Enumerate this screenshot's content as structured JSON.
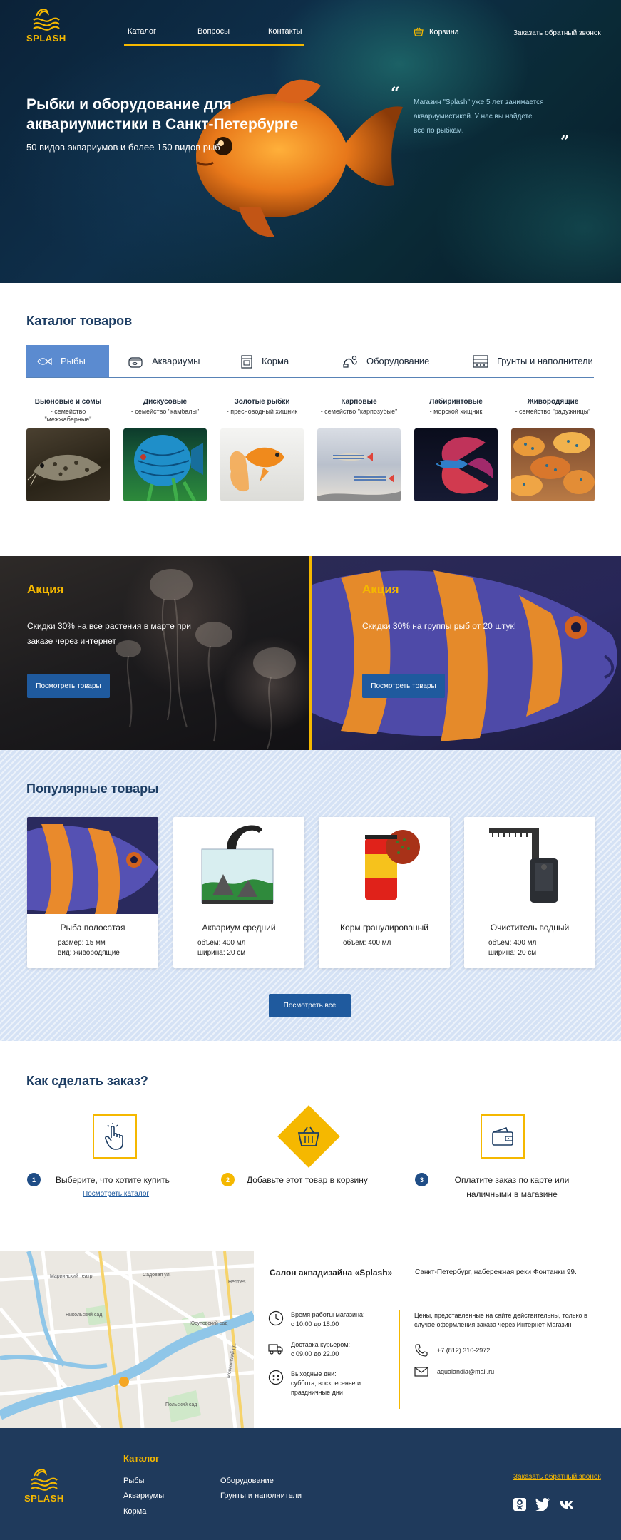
{
  "colors": {
    "accent": "#f5b800",
    "primary": "#1f5a9e",
    "heading": "#1d3d63",
    "tab_active": "#5b8bd0",
    "footer": "#1f3a5c"
  },
  "header": {
    "logo_text": "SPLASH",
    "nav": [
      "Каталог",
      "Вопросы",
      "Контакты"
    ],
    "cart_label": "Корзина",
    "callback": "Заказать обратный звонок"
  },
  "hero": {
    "title_line1": "Рыбки и оборудование для",
    "title_line2": "аквариумистики в Санкт-Петербурге",
    "subtitle": "50 видов аквариумов и более 150 видов рыб",
    "quote_line1": "Магазин \"Splash\" уже 5 лет занимается",
    "quote_line2": "аквариумистикой. У нас вы найдете",
    "quote_line3": "все по рыбкам."
  },
  "catalog": {
    "title": "Каталог товаров",
    "tabs": [
      {
        "label": "Рыбы",
        "icon": "fish-icon"
      },
      {
        "label": "Аквариумы",
        "icon": "aquarium-icon"
      },
      {
        "label": "Корма",
        "icon": "food-icon"
      },
      {
        "label": "Оборудование",
        "icon": "equipment-icon"
      },
      {
        "label": "Грунты и наполнители",
        "icon": "soil-icon"
      }
    ],
    "items": [
      {
        "name": "Вьюновые и сомы",
        "desc1": "- семейство",
        "desc2": "\"межжаберные\""
      },
      {
        "name": "Дискусовые",
        "desc1": "- семейство \"камбалы\"",
        "desc2": ""
      },
      {
        "name": "Золотые рыбки",
        "desc1": "- пресноводный хищник",
        "desc2": ""
      },
      {
        "name": "Карповые",
        "desc1": "- семейство \"карпозубые\"",
        "desc2": ""
      },
      {
        "name": "Лабиринтовые",
        "desc1": "- морской хищник",
        "desc2": ""
      },
      {
        "name": "Живородящие",
        "desc1": "- семейство \"радужницы\"",
        "desc2": ""
      }
    ]
  },
  "promos": [
    {
      "title": "Акция",
      "line1": "Скидки 30% на все растения в марте при",
      "line2": "заказе через интернет",
      "button": "Посмотреть товары"
    },
    {
      "title": "Акция",
      "line1": "Скидки 30% на группы рыб от 20 штук!",
      "line2": "",
      "button": "Посмотреть товары"
    }
  ],
  "popular": {
    "title": "Популярные товары",
    "products": [
      {
        "name": "Рыба полосатая",
        "spec1": "размер: 15 мм",
        "spec2": "вид: живородящие"
      },
      {
        "name": "Аквариум средний",
        "spec1": "объем: 400 мл",
        "spec2": "ширина: 20 см"
      },
      {
        "name": "Корм гранулированый",
        "spec1": "объем: 400 мл",
        "spec2": ""
      },
      {
        "name": "Очиститель водный",
        "spec1": "объем: 400 мл",
        "spec2": "ширина: 20 см"
      }
    ],
    "button": "Посмотреть все"
  },
  "order": {
    "title": "Как сделать заказ?",
    "steps": [
      {
        "num": "1",
        "text1": "Выберите, что хотите купить",
        "text2": "",
        "link": "Посмотреть каталог"
      },
      {
        "num": "2",
        "text1": "Добавьте этот товар в корзину",
        "text2": ""
      },
      {
        "num": "3",
        "text1": "Оплатите  заказ по карте или",
        "text2": "наличными в магазине"
      }
    ]
  },
  "info": {
    "salon": "Салон аквадизайна «Splash»",
    "address": "Санкт-Петербург, набережная реки Фонтанки 99.",
    "hours_label": "Время работы магазина:",
    "hours_value": "с 10.00 до 18.00",
    "delivery_label": "Доставка курьером:",
    "delivery_value": "с 09.00 до 22.00",
    "days_off_label": "Выходные дни:",
    "days_off_value1": "суббота, воскресенье и",
    "days_off_value2": "праздничные дни",
    "note_line1": "Цены, представленные на сайте действительны, только в",
    "note_line2": "случае оформления заказа через Интернет-Магазин",
    "phone": "+7 (812) 310-2972",
    "email": "aqualandia@mail.ru",
    "map_labels": [
      "Мариинский театр",
      "Никольский сад",
      "Юсуповский сад",
      "Hermes",
      "Польский сад",
      "Московский пр.",
      "Садовая ул."
    ]
  },
  "footer": {
    "logo_text": "SPLASH",
    "catalog_title": "Каталог",
    "col1": [
      "Рыбы",
      "Аквариумы",
      "Корма"
    ],
    "col2": [
      "Оборудование",
      "Грунты и наполнители"
    ],
    "callback": "Заказать обратный звонок",
    "social": [
      "odnoklassniki-icon",
      "twitter-icon",
      "vk-icon"
    ]
  }
}
